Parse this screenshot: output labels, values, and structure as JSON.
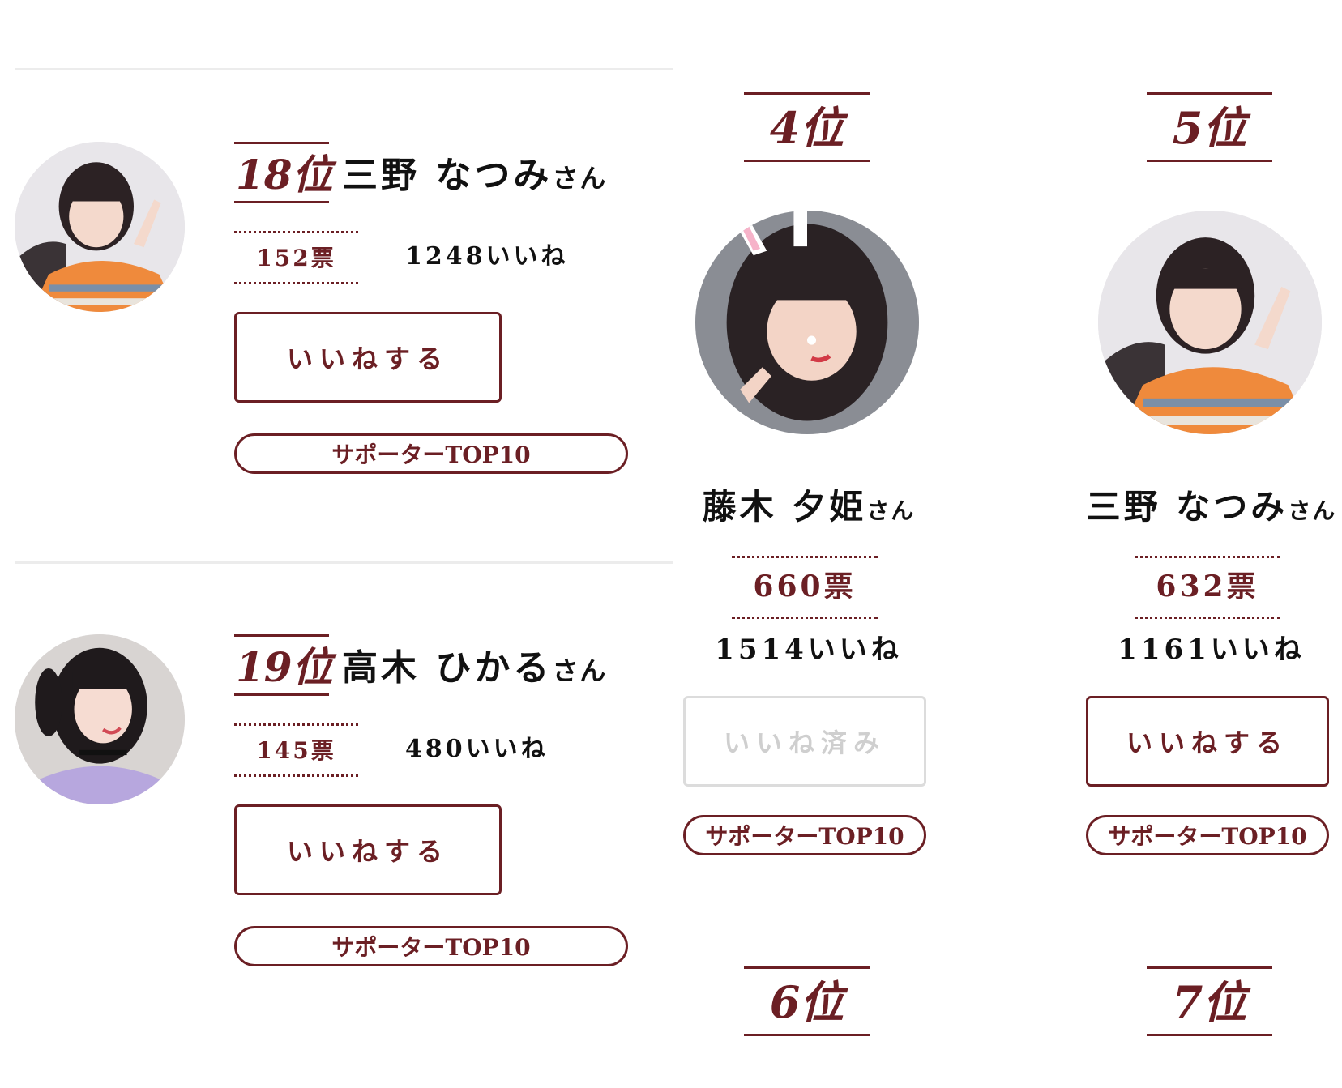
{
  "list": [
    {
      "rank": "18位",
      "name": "三野 なつみ",
      "honorific": "さん",
      "votes": "152票",
      "likes": "1248いいね",
      "like_button": "いいねする",
      "supporter_button": "サポーターTOP10"
    },
    {
      "rank": "19位",
      "name": "高木 ひかる",
      "honorific": "さん",
      "votes": "145票",
      "likes": "480いいね",
      "like_button": "いいねする",
      "supporter_button": "サポーターTOP10"
    }
  ],
  "grid": [
    {
      "rank": "4位",
      "name": "藤木 夕姫",
      "honorific": "さん",
      "votes": "660票",
      "likes": "1514いいね",
      "like_button": "いいね済み",
      "liked": true,
      "supporter_button": "サポーターTOP10"
    },
    {
      "rank": "5位",
      "name": "三野 なつみ",
      "honorific": "さん",
      "votes": "632票",
      "likes": "1161いいね",
      "like_button": "いいねする",
      "liked": false,
      "supporter_button": "サポーターTOP10"
    }
  ],
  "next_ranks": [
    "6位",
    "7位"
  ],
  "colors": {
    "accent": "#6b1f24",
    "disabled": "#cfcfcf",
    "divider": "#ececec"
  }
}
